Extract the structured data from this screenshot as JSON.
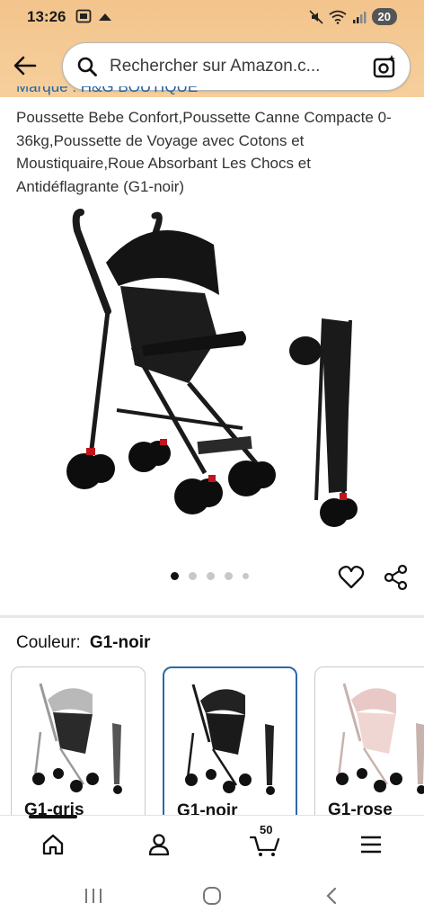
{
  "status_bar": {
    "time": "13:26",
    "battery": "20"
  },
  "search": {
    "placeholder": "Rechercher sur Amazon.c..."
  },
  "product": {
    "brand_line": "Marque : H&G BOUTIQUE",
    "title": "Poussette Bebe Confort,Poussette Canne Compacte 0-36kg,Poussette de Voyage avec Cotons et Moustiquaire,Roue Absorbant Les Chocs et Antidéflagrante (G1-noir)",
    "image_count": 5,
    "active_image": 1
  },
  "color_selector": {
    "label": "Couleur:",
    "selected": "G1-noir",
    "options": [
      {
        "name": "G1-gris",
        "frame": "#9a9a9a",
        "canopy": "#b9b9b9"
      },
      {
        "name": "G1-noir",
        "frame": "#1a1a1a",
        "canopy": "#222222"
      },
      {
        "name": "G1-rose",
        "frame": "#c7b2ad",
        "canopy": "#e9c9c6"
      }
    ]
  },
  "bottom_nav": {
    "items": [
      "home-icon",
      "account-icon",
      "cart-icon",
      "menu-icon"
    ],
    "cart_count": "50"
  },
  "colors": {
    "header": "#f3c48c",
    "link": "#2162a1",
    "selected_border": "#2a6aa6"
  }
}
